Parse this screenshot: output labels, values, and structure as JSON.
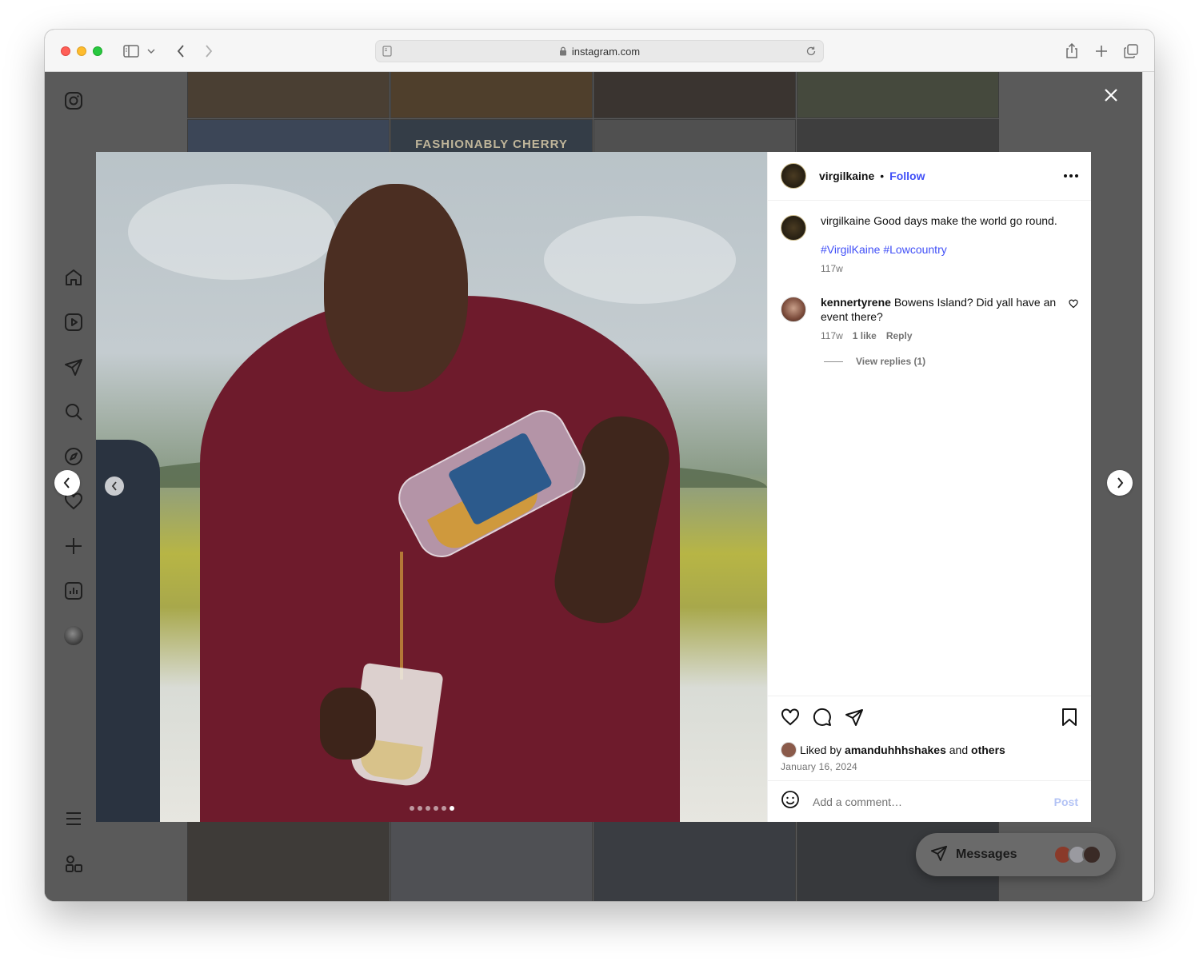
{
  "browser": {
    "url": "instagram.com"
  },
  "grid": {
    "tile_label": "FASHIONABLY CHERRY"
  },
  "post": {
    "username": "virgilkaine",
    "follow_label": "Follow",
    "separator": "•",
    "caption": {
      "username": "virgilkaine",
      "text": "Good days make the world go round.",
      "hashtags": "#VirgilKaine #Lowcountry",
      "age": "117w"
    },
    "comments": [
      {
        "username": "kennertyrene",
        "text": "Bowens Island? Did yall have an event there?",
        "age": "117w",
        "likes": "1 like",
        "reply_label": "Reply",
        "view_replies": "View replies (1)"
      }
    ],
    "liked_by_prefix": "Liked by",
    "liked_by_user": "amanduhhhshakes",
    "liked_by_and": "and",
    "liked_by_others": "others",
    "date": "January 16, 2024",
    "comment_placeholder": "Add a comment…",
    "post_label": "Post",
    "carousel_count": 6,
    "carousel_active_index": 5
  },
  "messages": {
    "label": "Messages"
  },
  "colors": {
    "accent": "#4150f7",
    "post_disabled": "#b3c3f5",
    "overlay": "#5a5a5a"
  }
}
